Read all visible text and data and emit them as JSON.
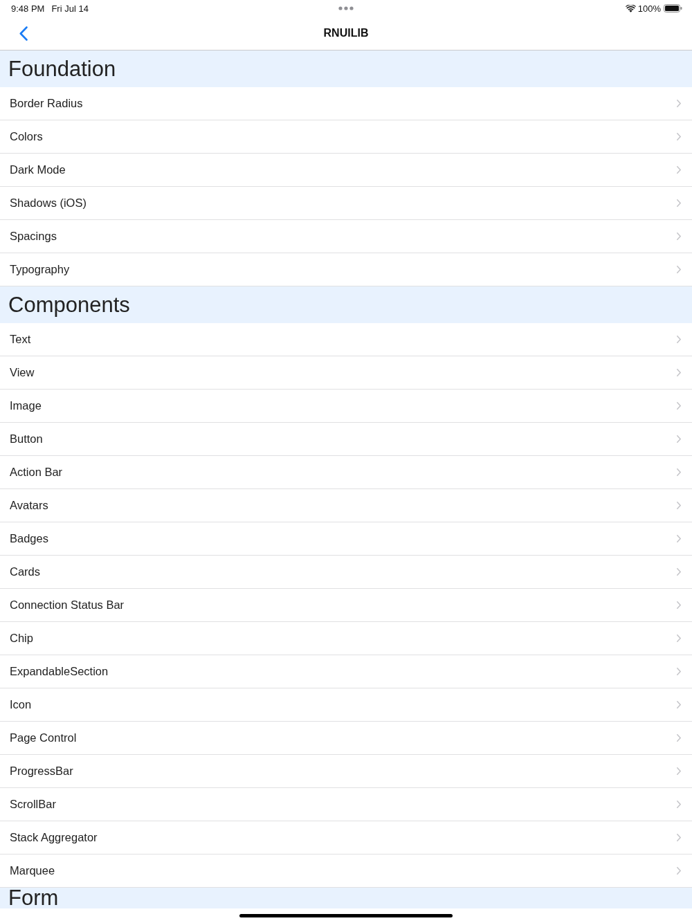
{
  "status_bar": {
    "time": "9:48 PM",
    "date": "Fri Jul 14",
    "battery": "100%"
  },
  "nav_bar": {
    "title": "RNUILIB"
  },
  "sections": [
    {
      "title": "Foundation",
      "items": [
        "Border Radius",
        "Colors",
        "Dark Mode",
        "Shadows (iOS)",
        "Spacings",
        "Typography"
      ]
    },
    {
      "title": "Components",
      "items": [
        "Text",
        "View",
        "Image",
        "Button",
        "Action Bar",
        "Avatars",
        "Badges",
        "Cards",
        "Connection Status Bar",
        "Chip",
        "ExpandableSection",
        "Icon",
        "Page Control",
        "ProgressBar",
        "ScrollBar",
        "Stack Aggregator",
        "Marquee"
      ]
    },
    {
      "title": "Form"
    }
  ]
}
